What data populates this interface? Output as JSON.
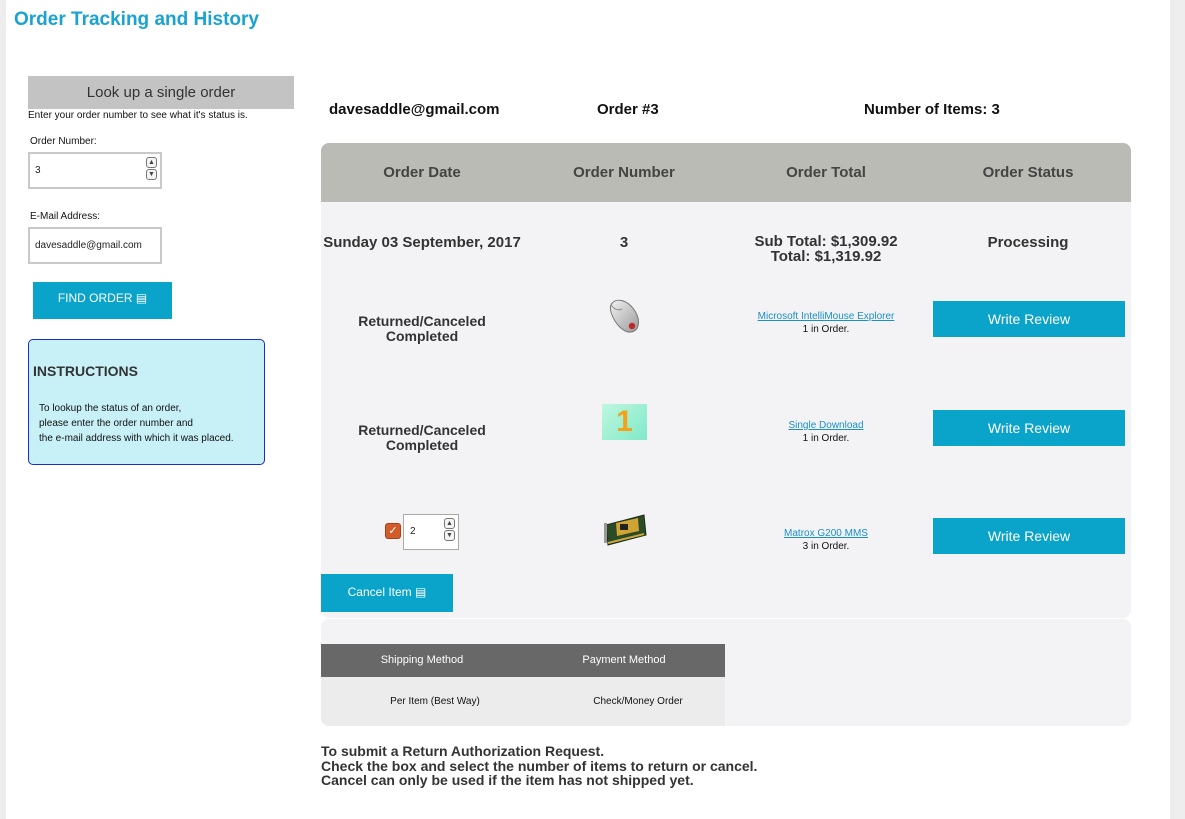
{
  "page": {
    "title": "Order Tracking and History"
  },
  "lookup": {
    "header": "Look up a single order",
    "help": "Enter your order number to see what it's status is.",
    "order_number_label": "Order Number:",
    "order_number_value": "3",
    "email_label": "E-Mail Address:",
    "email_value": "davesaddle@gmail.com",
    "find_button": "FIND ORDER ▤"
  },
  "instructions": {
    "title": "INSTRUCTIONS",
    "lines": [
      "To lookup the status of an order,",
      "please enter the order number and",
      "the e-mail address with which it was placed."
    ]
  },
  "summary": {
    "email": "davesaddle@gmail.com",
    "order": "Order #3",
    "items": "Number of Items: 3"
  },
  "order_table": {
    "headers": [
      "Order Date",
      "Order Number",
      "Order Total",
      "Order Status"
    ],
    "date": "Sunday 03 September, 2017",
    "number": "3",
    "subtotal": "Sub Total: $1,309.92",
    "total": "Total: $1,319.92",
    "status": "Processing"
  },
  "items": [
    {
      "status_line1": "Returned/Canceled",
      "status_line2": "Completed",
      "name": "Microsoft IntelliMouse Explorer",
      "qty": "1 in Order.",
      "review": "Write Review",
      "image": "mouse-image"
    },
    {
      "status_line1": "Returned/Canceled",
      "status_line2": "Completed",
      "name": "Single Download",
      "qty": "1 in Order.",
      "review": "Write Review",
      "image": "download-image"
    },
    {
      "return_qty": "2",
      "checked": true,
      "name": "Matrox G200 MMS",
      "qty": "3 in Order.",
      "review": "Write Review",
      "image": "graphics-card-image"
    }
  ],
  "download_badge": "1",
  "cancel_button": "Cancel Item ▤",
  "shipping": {
    "headers": [
      "Shipping Method",
      "Payment Method"
    ],
    "method": "Per Item (Best Way)",
    "payment": "Check/Money Order"
  },
  "footnote": [
    "To submit a Return Authorization Request.",
    "Check the box and select the number of items to return or cancel.",
    "Cancel can only be used if the item has not shipped yet."
  ],
  "colors": {
    "accent": "#0aa3c9",
    "title": "#1aa3d0",
    "instructions_bg": "#c8f1f7",
    "checkbox": "#d25c2a"
  }
}
